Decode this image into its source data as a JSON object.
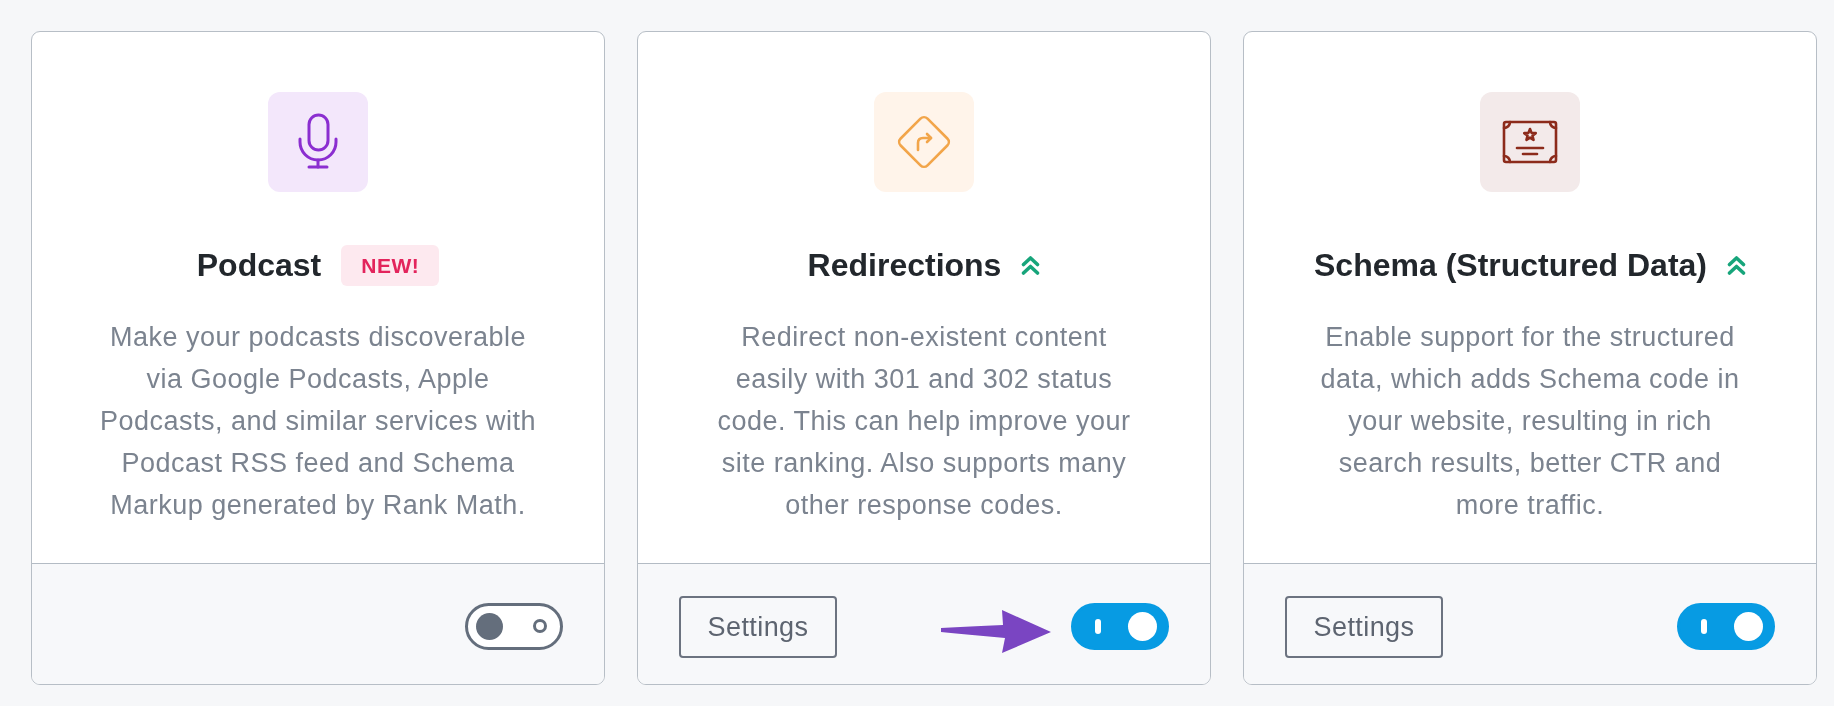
{
  "modules": [
    {
      "title": "Podcast",
      "badge": {
        "kind": "label",
        "text": "NEW!"
      },
      "description": "Make your podcasts discoverable via Google Podcasts, Apple Podcasts, and similar services with Podcast RSS feed and Schema Markup generated by Rank Math.",
      "on": false,
      "arrow": false
    },
    {
      "title": "Redirections",
      "badge": {
        "kind": "chevrons"
      },
      "description": "Redirect non-existent content easily with 301 and 302 status code. This can help improve your site ranking. Also supports many other response codes.",
      "settings_button": "Settings",
      "on": true,
      "arrow": true
    },
    {
      "title": "Schema (Structured Data)",
      "badge": {
        "kind": "chevrons"
      },
      "description": "Enable support for the structured data, which adds Schema code in your website, resulting in rich search results, better CTR and more traffic.",
      "settings_button": "Settings",
      "on": true,
      "arrow": false
    }
  ]
}
